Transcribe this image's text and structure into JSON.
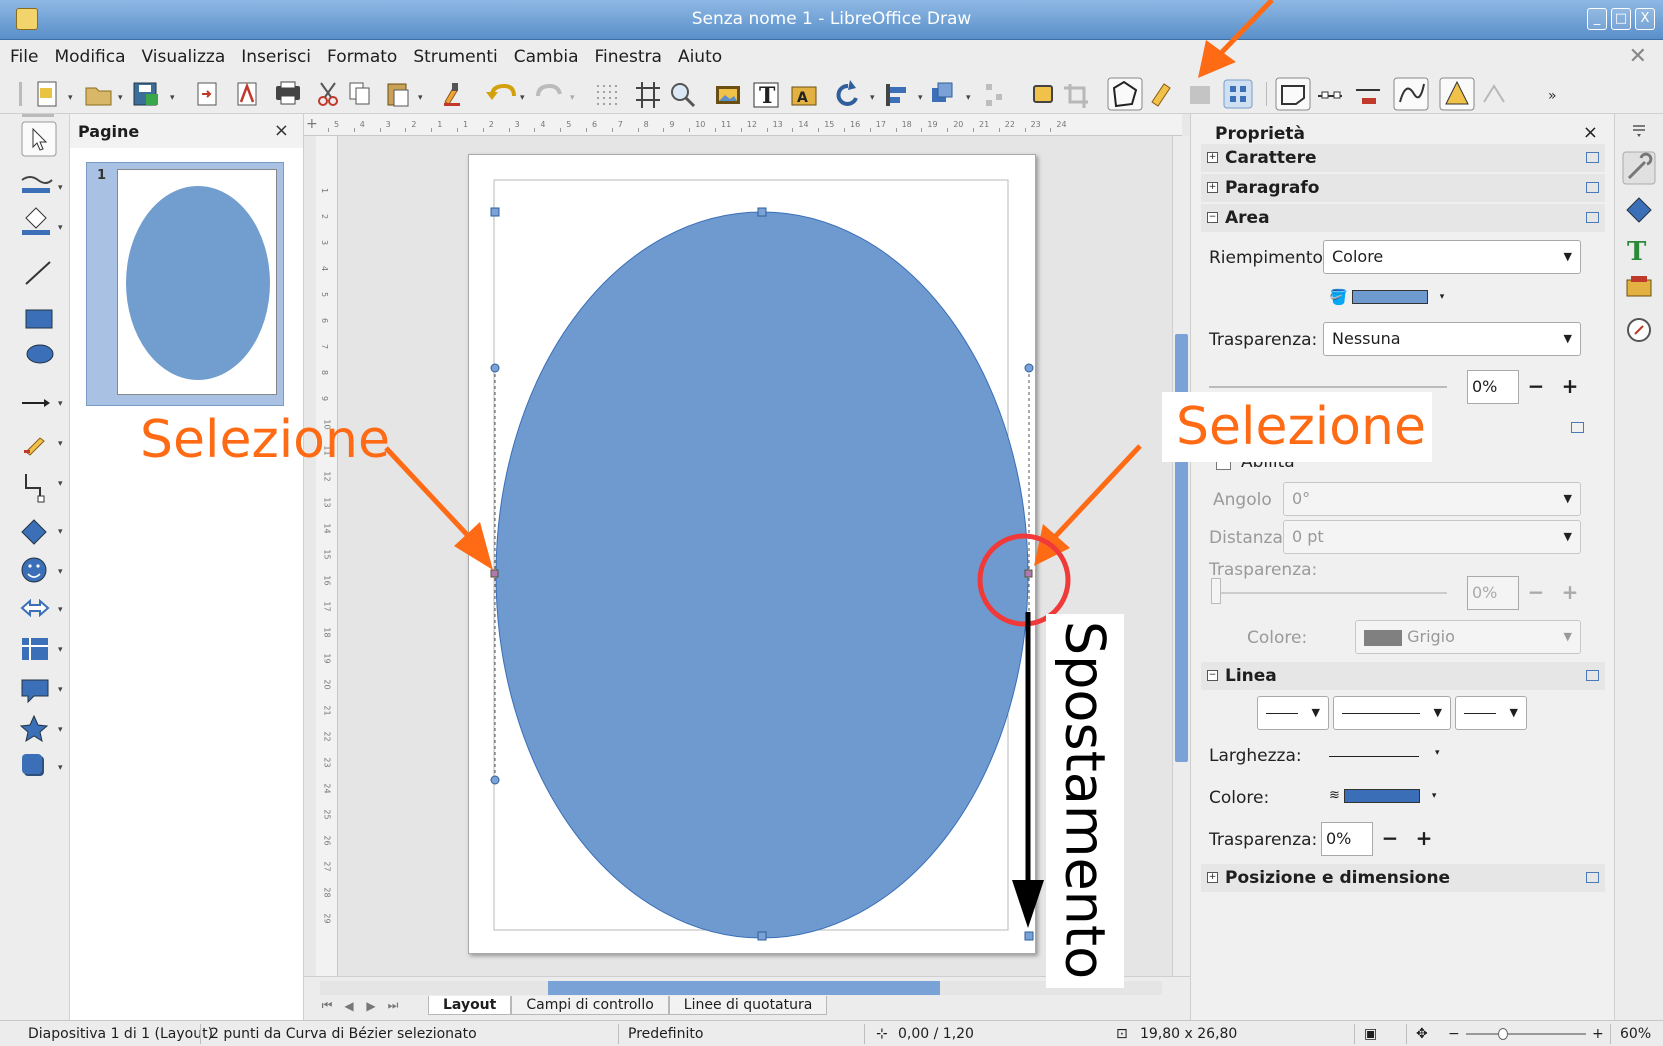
{
  "window": {
    "title": "Senza nome 1 - LibreOffice Draw",
    "buttons": [
      "_",
      "□",
      "X"
    ]
  },
  "menu": [
    "File",
    "Modifica",
    "Visualizza",
    "Inserisci",
    "Formato",
    "Strumenti",
    "Cambia",
    "Finestra",
    "Aiuto"
  ],
  "toolbar": {
    "icons": [
      "new-document",
      "open",
      "save",
      "export",
      "export-pdf",
      "print",
      "cut",
      "copy",
      "paste",
      "clone-formatting",
      "undo",
      "redo",
      "grid",
      "helplines",
      "zoom-pan",
      "image",
      "text-box",
      "fontwork",
      "rotate",
      "align",
      "arrange",
      "distribute",
      "shadow",
      "crop",
      "points",
      "glue-points",
      "toggle-extrusion",
      "transformations",
      "show-draw-functions",
      "insert-points",
      "delete-points",
      "convert-to-curve",
      "symmetric-transition",
      "more"
    ]
  },
  "slide_panel": {
    "title": "Pagine",
    "close": "×",
    "slide_number": "1"
  },
  "ruler": {
    "h_labels": [
      "5",
      "4",
      "3",
      "2",
      "1",
      "1",
      "2",
      "3",
      "4",
      "5",
      "6",
      "7",
      "8",
      "9",
      "10",
      "11",
      "12",
      "13",
      "14",
      "15",
      "16",
      "17",
      "18",
      "19",
      "20",
      "21",
      "22",
      "23",
      "24"
    ],
    "v_labels": [
      "1",
      "2",
      "3",
      "4",
      "5",
      "6",
      "7",
      "8",
      "9",
      "10",
      "11",
      "12",
      "13",
      "14",
      "15",
      "16",
      "17",
      "18",
      "19",
      "20",
      "21",
      "22",
      "23",
      "24",
      "25",
      "26",
      "27",
      "28",
      "29"
    ]
  },
  "tabs": {
    "items": [
      "Layout",
      "Campi di controllo",
      "Linee di quotatura"
    ],
    "active": 0
  },
  "sidebar": {
    "title": "Proprietà",
    "close": "×",
    "sections": {
      "carattere": "Carattere",
      "paragrafo": "Paragrafo",
      "area": "Area",
      "linea": "Linea",
      "posizione": "Posizione e dimensione"
    },
    "area": {
      "fill_label": "Riempimento:",
      "fill_value": "Colore",
      "fill_color": "#6f9ad0",
      "transparency_label": "Trasparenza:",
      "transparency_value": "Nessuna",
      "transparency_percent": "0%"
    },
    "shadow": {
      "enable_label": "Abilita",
      "angle_label": "Angolo",
      "angle_value": "0°",
      "distance_label": "Distanza",
      "distance_value": "0 pt",
      "transparency_label": "Trasparenza:",
      "transparency_percent": "0%",
      "color_label": "Colore:",
      "color_value": "Grigio",
      "color_hex": "#808080"
    },
    "line": {
      "width_label": "Larghezza:",
      "color_label": "Colore:",
      "color_hex": "#3a6fb7",
      "transparency_label": "Trasparenza:",
      "transparency_value": "0%"
    }
  },
  "statusbar": {
    "slide": "Diapositiva 1 di 1 (Layout)",
    "selection": "2 punti da Curva di Bézier selezionato",
    "style": "Predefinito",
    "position": "0,00 / 1,20",
    "size": "19,80 x 26,80",
    "zoom": "60%"
  },
  "annotations": {
    "selection_left": "Selezione",
    "selection_right": "Selezione",
    "movement": "Spostamento",
    "accent": "#ff6a14"
  },
  "shape": {
    "fill": "#6f9ad0",
    "stroke": "#3a6fb7"
  }
}
